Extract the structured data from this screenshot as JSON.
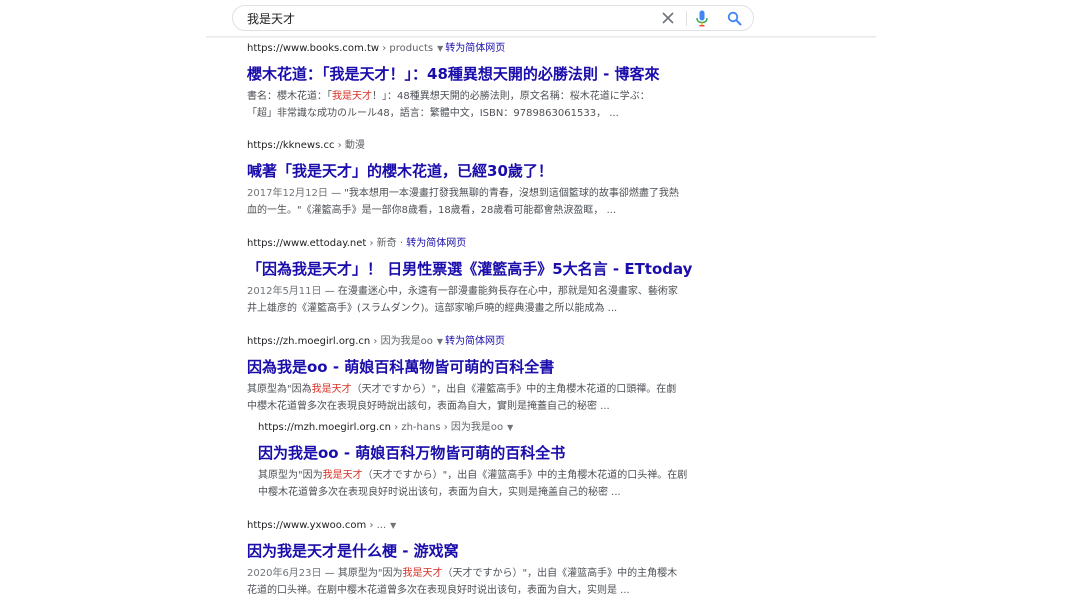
{
  "search": {
    "query": "我是天才"
  },
  "icons": {
    "clear": "close-icon",
    "mic": "mic-icon",
    "search": "search-icon",
    "dropdown": "dropdown-triangle-icon"
  },
  "colors": {
    "link": "#1a0dab",
    "highlight": "#d93025",
    "snippet": "#4d5156"
  },
  "results": [
    {
      "domain": "https://www.books.com.tw",
      "crumb": " › products",
      "translate": "转为简体网页",
      "title": "櫻木花道：「我是天才！」：48種異想天開的必勝法則 - 博客來",
      "line1_pre": "書名：櫻木花道：「",
      "line1_hl": "我是天才",
      "line1_post": "！」：48種異想天開的必勝法則，原文名稱：桜木花道に学ぶ：",
      "line2": "「超」非常識な成功のルール48，語言：繁體中文，ISBN：9789863061533， ..."
    },
    {
      "domain": "https://kknews.cc",
      "crumb": " › 動漫",
      "title": "喊著「我是天才」的櫻木花道，已經30歲了！",
      "date": "2017年12月12日",
      "line1": " — \"我本想用一本漫畫打發我無聊的青春，沒想到這個籃球的故事卻燃盡了我熱",
      "line2": "血的一生。\"《灌籃高手》是一部你8歲看，18歲看，28歲看可能都會熱淚盈眶， ..."
    },
    {
      "domain": "https://www.ettoday.net",
      "crumb": " › 新奇",
      "translate": "转为简体网页",
      "title": "「因為我是天才」！ 日男性票選《灌籃高手》5大名言 - ETtoday",
      "date": "2012年5月11日",
      "line1": " — 在漫畫迷心中，永遠有一部漫畫能夠長存在心中，那就是知名漫畫家、藝術家",
      "line2": "井上雄彦的《灌籃高手》(スラムダンク)。這部家喻戶曉的經典漫畫之所以能成為 ..."
    },
    {
      "domain": "https://zh.moegirl.org.cn",
      "crumb": " › 因为我是oo",
      "translate": "转为简体网页",
      "title": "因為我是oo - 萌娘百科萬物皆可萌的百科全書",
      "line1_pre": "其原型為\"因為",
      "line1_hl": "我是天才",
      "line1_post": "（天才ですから）\"，出自《灌籃高手》中的主角櫻木花道的口頭禪。在劇",
      "line2": "中櫻木花道曾多次在表現良好時說出該句，表面為自大，實則是掩蓋自己的秘密 ..."
    },
    {
      "domain": "https://mzh.moegirl.org.cn",
      "crumb": " › zh-hans › 因为我是oo",
      "title": "因为我是oo - 萌娘百科万物皆可萌的百科全书",
      "line1_pre": "其原型为\"因为",
      "line1_hl": "我是天才",
      "line1_post": "（天才ですから）\"，出自《灌篮高手》中的主角樱木花道的口头禅。在剧",
      "line2": "中樱木花道曾多次在表现良好时说出该句，表面为自大，实则是掩盖自己的秘密 ..."
    },
    {
      "domain": "https://www.yxwoo.com",
      "crumb": " › ...",
      "title": "因为我是天才是什么梗 - 游戏窝",
      "date": "2020年6月23日",
      "line1_pre": " — 其原型为\"因为",
      "line1_hl": "我是天才",
      "line1_post": "（天才ですから）\"，出自《灌篮高手》中的主角樱木",
      "line2": "花道的口头禅。在剧中樱木花道曾多次在表现良好时说出该句，表面为自大，实则是 ..."
    }
  ]
}
